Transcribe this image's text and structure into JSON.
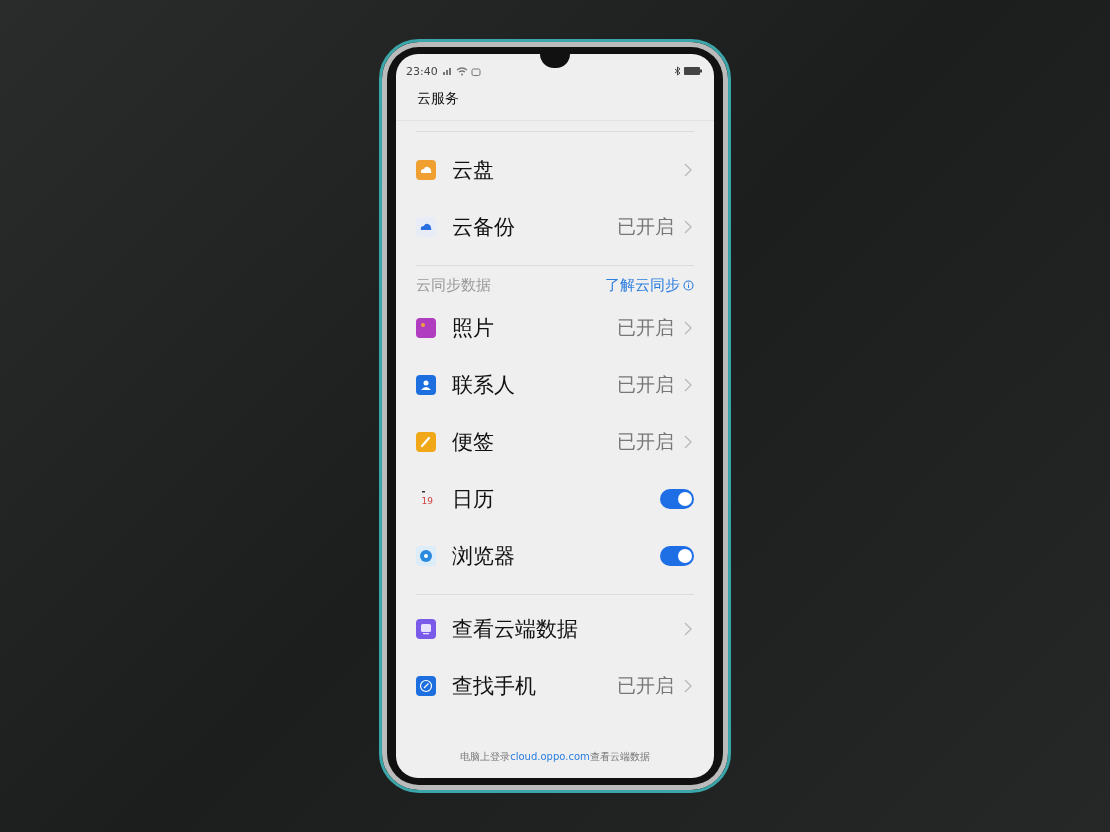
{
  "status_bar": {
    "time": "23:40"
  },
  "header": {
    "title": "云服务"
  },
  "groups": [
    {
      "items": [
        {
          "kind": "link",
          "label": "云盘"
        },
        {
          "kind": "link",
          "label": "云备份",
          "status": "已开启"
        }
      ]
    },
    {
      "section": {
        "title": "云同步数据",
        "link": "了解云同步"
      },
      "items": [
        {
          "kind": "link",
          "label": "照片",
          "status": "已开启"
        },
        {
          "kind": "link",
          "label": "联系人",
          "status": "已开启"
        },
        {
          "kind": "link",
          "label": "便签",
          "status": "已开启"
        },
        {
          "kind": "toggle",
          "label": "日历",
          "on": true,
          "icon_text": "19"
        },
        {
          "kind": "toggle",
          "label": "浏览器",
          "on": true
        }
      ]
    },
    {
      "items": [
        {
          "kind": "link",
          "label": "查看云端数据"
        },
        {
          "kind": "link",
          "label": "查找手机",
          "status": "已开启"
        }
      ]
    }
  ],
  "footer": {
    "prefix": "电脑上登录",
    "link": "cloud.oppo.com",
    "suffix": "查看云端数据"
  }
}
